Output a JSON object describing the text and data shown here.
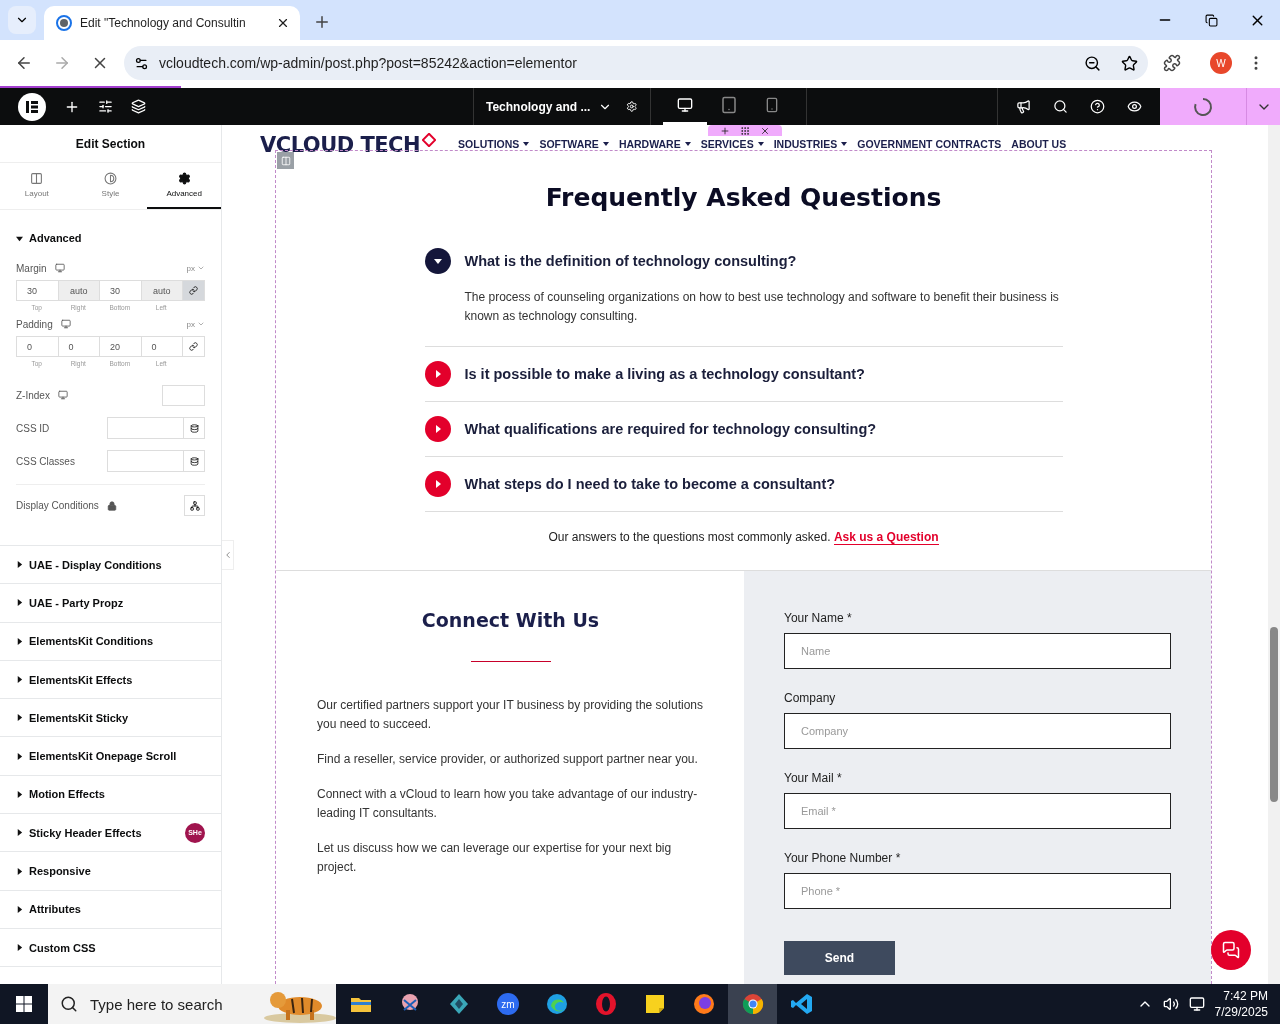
{
  "browser": {
    "tab_title": "Edit \"Technology and Consultin",
    "url": "vcloudtech.com/wp-admin/post.php?post=85242&action=elementor",
    "avatar": "W"
  },
  "editor_bar": {
    "document_title": "Technology and ...",
    "devices": [
      {
        "kind": "desktop",
        "selected": true
      },
      {
        "kind": "tablet",
        "selected": false
      },
      {
        "kind": "mobile",
        "selected": false
      }
    ]
  },
  "panel": {
    "title": "Edit Section",
    "tabs": [
      {
        "label": "Layout",
        "kind": "layout",
        "selected": false
      },
      {
        "label": "Style",
        "kind": "style",
        "selected": false
      },
      {
        "label": "Advanced",
        "kind": "advanced",
        "selected": true
      }
    ],
    "section": {
      "title": "Advanced",
      "expanded": true
    },
    "spacing": [
      {
        "label": "Margin",
        "unit": "px",
        "linked": true,
        "values": [
          {
            "value": "30",
            "caption": "Top",
            "auto": false
          },
          {
            "value": "auto",
            "caption": "Right",
            "auto": true
          },
          {
            "value": "30",
            "caption": "Bottom",
            "auto": false
          },
          {
            "value": "auto",
            "caption": "Left",
            "auto": true
          }
        ]
      },
      {
        "label": "Padding",
        "unit": "px",
        "linked": false,
        "values": [
          {
            "value": "0",
            "caption": "Top",
            "auto": false
          },
          {
            "value": "0",
            "caption": "Right",
            "auto": false
          },
          {
            "value": "20",
            "caption": "Bottom",
            "auto": false
          },
          {
            "value": "0",
            "caption": "Left",
            "auto": false
          }
        ]
      }
    ],
    "z_index_label": "Z-Index",
    "css_id_label": "CSS ID",
    "css_classes_label": "CSS Classes",
    "display_conditions_label": "Display Conditions",
    "collapsed_sections": [
      {
        "title": "UAE - Display Conditions"
      },
      {
        "title": "UAE - Party Propz"
      },
      {
        "title": "ElementsKit Conditions"
      },
      {
        "title": "ElementsKit Effects"
      },
      {
        "title": "ElementsKit Sticky"
      },
      {
        "title": "ElementsKit Onepage Scroll"
      },
      {
        "title": "Motion Effects"
      },
      {
        "title": "Sticky Header Effects",
        "badge": "SHe"
      },
      {
        "title": "Responsive"
      },
      {
        "title": "Attributes"
      },
      {
        "title": "Custom CSS"
      }
    ]
  },
  "site": {
    "logo_text": "VCLOUD TECH",
    "nav": [
      {
        "label": "SOLUTIONS",
        "dropdown": true
      },
      {
        "label": "SOFTWARE",
        "dropdown": true
      },
      {
        "label": "HARDWARE",
        "dropdown": true
      },
      {
        "label": "SERVICES",
        "dropdown": true
      },
      {
        "label": "INDUSTRIES",
        "dropdown": true
      },
      {
        "label": "GOVERNMENT CONTRACTS",
        "dropdown": false
      },
      {
        "label": "ABOUT US",
        "dropdown": false
      }
    ],
    "faq": {
      "title": "Frequently Asked Questions",
      "items": [
        {
          "question": "What is the definition of technology consulting?",
          "expanded": true,
          "answer": "The process of counseling organizations on how to best use technology and software to benefit their business is known as technology consulting."
        },
        {
          "question": "Is it possible to make a living as a technology consultant?",
          "expanded": false
        },
        {
          "question": "What qualifications are required for technology consulting?",
          "expanded": false
        },
        {
          "question": "What steps do I need to take to become a consultant?",
          "expanded": false
        }
      ],
      "footer_text": "Our answers to the questions most commonly asked.",
      "footer_link": "Ask us a Question"
    },
    "connect": {
      "title": "Connect With Us",
      "paragraphs": [
        "Our certified partners support your IT business by providing the solutions you need to succeed.",
        "Find a reseller, service provider, or authorized support partner near you.",
        "Connect with a vCloud to learn how you take advantage of our industry-leading IT consultants.",
        "Let us discuss how we can leverage our expertise for your next big project."
      ],
      "fields": [
        {
          "label": "Your Name *",
          "placeholder": "Name"
        },
        {
          "label": "Company",
          "placeholder": "Company"
        },
        {
          "label": "Your Mail *",
          "placeholder": "Email *"
        },
        {
          "label": "Your Phone Number *",
          "placeholder": "Phone *"
        }
      ],
      "button": "Send"
    }
  },
  "taskbar": {
    "search_placeholder": "Type here to search",
    "apps": [
      {
        "kind": "explorer",
        "selected": false
      },
      {
        "kind": "snip",
        "selected": false
      },
      {
        "kind": "gem",
        "selected": false
      },
      {
        "kind": "zoom",
        "label": "zm",
        "selected": false
      },
      {
        "kind": "edge",
        "selected": false
      },
      {
        "kind": "opera",
        "selected": false
      },
      {
        "kind": "notes",
        "selected": false
      },
      {
        "kind": "firefox",
        "selected": false
      },
      {
        "kind": "chrome",
        "selected": true
      },
      {
        "kind": "vscode",
        "selected": false
      }
    ],
    "time": "7:42 PM",
    "date": "7/29/2025"
  }
}
